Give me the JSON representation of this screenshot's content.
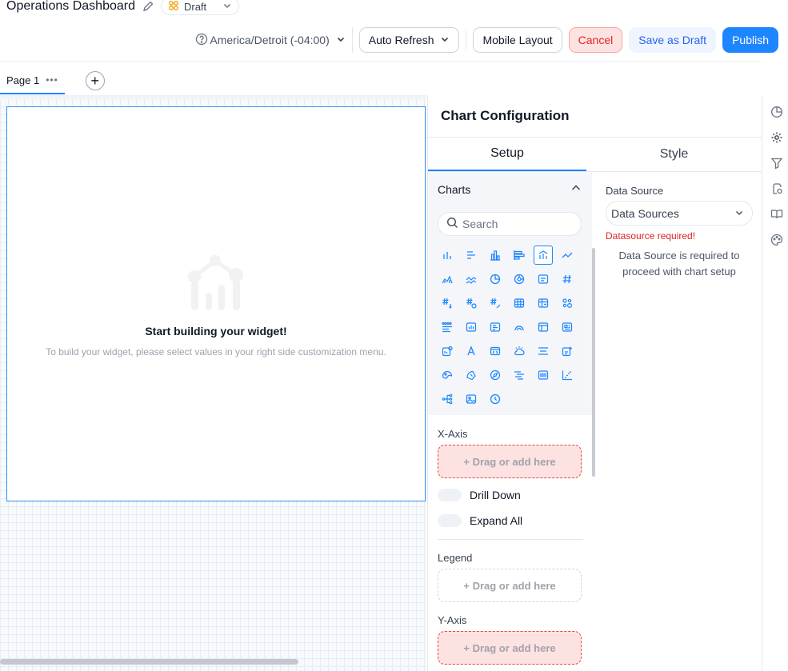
{
  "header": {
    "title": "Operations Dashboard",
    "status": "Draft",
    "timezone": "America/Detroit (-04:00)",
    "auto_refresh": "Auto Refresh",
    "mobile_layout": "Mobile Layout",
    "cancel": "Cancel",
    "save_draft": "Save as Draft",
    "publish": "Publish"
  },
  "pages": {
    "tab_label": "Page 1",
    "tab_menu": "•••",
    "add": "+"
  },
  "widget": {
    "title": "Start building your widget!",
    "subtitle": "To build your widget, please select values in your right side customization menu."
  },
  "config": {
    "title": "Chart Configuration",
    "tabs": [
      "Setup",
      "Style"
    ],
    "charts_label": "Charts",
    "search_placeholder": "Search",
    "xaxis_label": "X-Axis",
    "drop_text": "+ Drag or add here",
    "drill_down": "Drill Down",
    "expand_all": "Expand All",
    "legend_label": "Legend",
    "yaxis_label": "Y-Axis",
    "data_source_label": "Data Source",
    "data_source_value": "Data Sources",
    "data_source_error": "Datasource required!",
    "data_source_help": "Data Source is required to proceed with chart setup"
  },
  "colors": {
    "accent": "#1d86ff",
    "danger": "#dc2626",
    "warning": "#f59e0b"
  }
}
